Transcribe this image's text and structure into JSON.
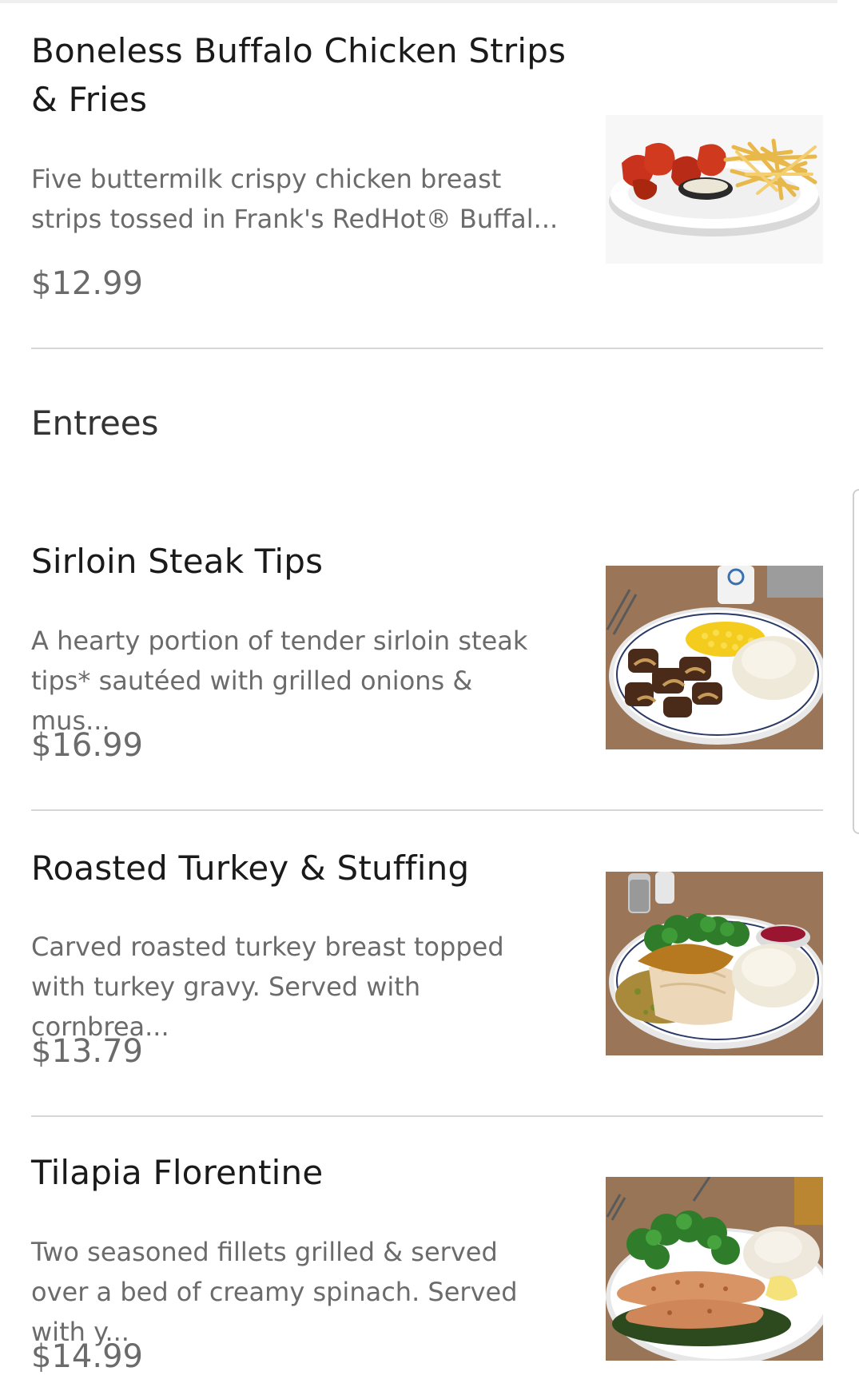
{
  "menu": {
    "items": [
      {
        "title": "Boneless Buffalo Chicken Strips & Fries",
        "description": "Five buttermilk crispy chicken breast strips  tossed in Frank's RedHot® Buffal...",
        "price": "$12.99"
      },
      {
        "title": "Sirloin Steak Tips",
        "description": "A hearty portion of tender sirloin steak tips* sautéed with grilled onions & mus...",
        "price": "$16.99"
      },
      {
        "title": "Roasted Turkey & Stuffing",
        "description": "Carved roasted turkey breast topped with turkey gravy. Served with cornbrea...",
        "price": "$13.79"
      },
      {
        "title": "Tilapia Florentine",
        "description": "Two seasoned fillets grilled & served over a bed of creamy spinach. Served with y...",
        "price": "$14.99"
      }
    ],
    "sections": {
      "entrees": "Entrees"
    }
  }
}
